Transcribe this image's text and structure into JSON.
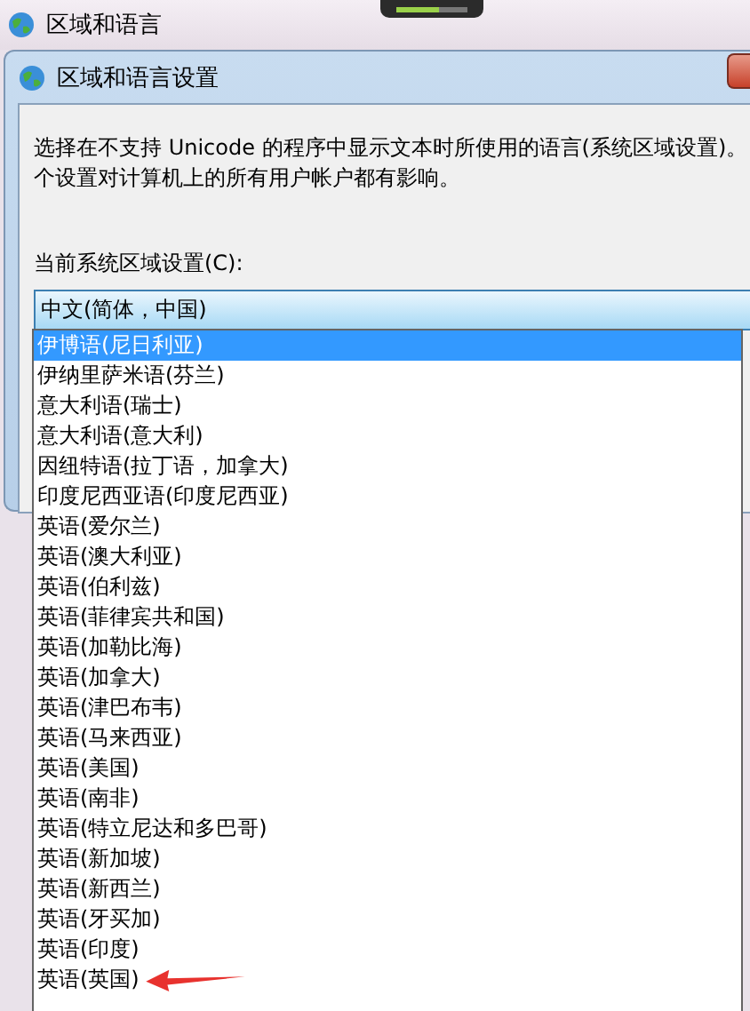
{
  "window": {
    "title": "区域和语言"
  },
  "dialog": {
    "title": "区域和语言设置",
    "description_lines": [
      "选择在不支持 Unicode 的程序中显示文本时所使用的语言(系统区域设置)。",
      "个设置对计算机上的所有用户帐户都有影响。"
    ],
    "locale_label": "当前系统区域设置(C):",
    "locale_combo": {
      "value": "中文(简体，中国)"
    },
    "dropdown": {
      "items": [
        {
          "label": "伊博语(尼日利亚)",
          "selected": true,
          "marked": false
        },
        {
          "label": "伊纳里萨米语(芬兰)",
          "selected": false,
          "marked": false
        },
        {
          "label": "意大利语(瑞士)",
          "selected": false,
          "marked": false
        },
        {
          "label": "意大利语(意大利)",
          "selected": false,
          "marked": false
        },
        {
          "label": "因纽特语(拉丁语，加拿大)",
          "selected": false,
          "marked": false
        },
        {
          "label": "印度尼西亚语(印度尼西亚)",
          "selected": false,
          "marked": false
        },
        {
          "label": "英语(爱尔兰)",
          "selected": false,
          "marked": false
        },
        {
          "label": "英语(澳大利亚)",
          "selected": false,
          "marked": false
        },
        {
          "label": "英语(伯利兹)",
          "selected": false,
          "marked": false
        },
        {
          "label": "英语(菲律宾共和国)",
          "selected": false,
          "marked": false
        },
        {
          "label": "英语(加勒比海)",
          "selected": false,
          "marked": false
        },
        {
          "label": "英语(加拿大)",
          "selected": false,
          "marked": false
        },
        {
          "label": "英语(津巴布韦)",
          "selected": false,
          "marked": false
        },
        {
          "label": "英语(马来西亚)",
          "selected": false,
          "marked": false
        },
        {
          "label": "英语(美国)",
          "selected": false,
          "marked": false
        },
        {
          "label": "英语(南非)",
          "selected": false,
          "marked": false
        },
        {
          "label": "英语(特立尼达和多巴哥)",
          "selected": false,
          "marked": false
        },
        {
          "label": "英语(新加坡)",
          "selected": false,
          "marked": false
        },
        {
          "label": "英语(新西兰)",
          "selected": false,
          "marked": false
        },
        {
          "label": "英语(牙买加)",
          "selected": false,
          "marked": false
        },
        {
          "label": "英语(印度)",
          "selected": false,
          "marked": false
        },
        {
          "label": "英语(英国)",
          "selected": false,
          "marked": true
        }
      ]
    }
  }
}
